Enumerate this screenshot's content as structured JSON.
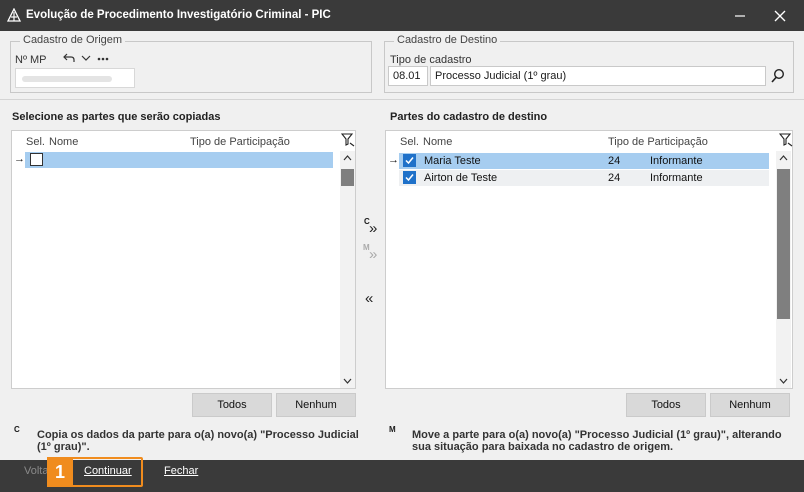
{
  "window": {
    "title": "Evolução de Procedimento Investigatório Criminal - PIC",
    "minimize_label": "—",
    "close_label": "✕"
  },
  "origem": {
    "legend": "Cadastro de Origem",
    "mp_label": "Nº MP",
    "undo_glyph": "↶",
    "menu_glyph": "⌵",
    "more_glyph": "⋯"
  },
  "destino": {
    "legend": "Cadastro de Destino",
    "tipo_label": "Tipo de cadastro",
    "tipo_code": "08.01",
    "tipo_name": "Processo Judicial (1º grau)"
  },
  "left_panel": {
    "title": "Selecione as partes que serão copiadas",
    "columns": [
      "Sel.",
      "Nome",
      "Tipo de Participação"
    ],
    "rows": [
      {
        "marker": "→",
        "checked": false,
        "nome": "",
        "codigo": "",
        "tipo": ""
      }
    ],
    "buttons": {
      "todos": "Todos",
      "nenhum": "Nenhum"
    }
  },
  "right_panel": {
    "title": "Partes do cadastro de destino",
    "columns": [
      "Sel.",
      "Nome",
      "Tipo de Participação"
    ],
    "rows": [
      {
        "marker": "→",
        "checked": true,
        "nome": "Maria Teste",
        "codigo": "24",
        "tipo": "Informante"
      },
      {
        "marker": "",
        "checked": true,
        "nome": "Airton de Teste",
        "codigo": "24",
        "tipo": "Informante"
      }
    ],
    "buttons": {
      "todos": "Todos",
      "nenhum": "Nenhum"
    }
  },
  "transfer": {
    "copy_letter": "C",
    "move_letter": "M",
    "copy_glyph": "»",
    "move_glyph": "»",
    "back_glyph": "«"
  },
  "hints": {
    "copy_letter": "C",
    "copy_text_1": "Copia os dados da parte para o(a) novo(a) \"Processo Judicial",
    "copy_text_2": "(1º grau)\".",
    "move_letter": "M",
    "move_text_1": "Move a parte para o(a) novo(a) \"Processo Judicial (1º grau)\", alterando",
    "move_text_2": "sua situação para baixada no cadastro de origem."
  },
  "footer": {
    "voltar": "Voltar",
    "continuar": "Continuar",
    "fechar": "Fechar",
    "step_number": "1"
  },
  "colors": {
    "titlebar": "#3a3a3a",
    "selected_row": "#a6cdf0",
    "checkbox_on": "#1f71c9",
    "highlight": "#f08c1e"
  }
}
